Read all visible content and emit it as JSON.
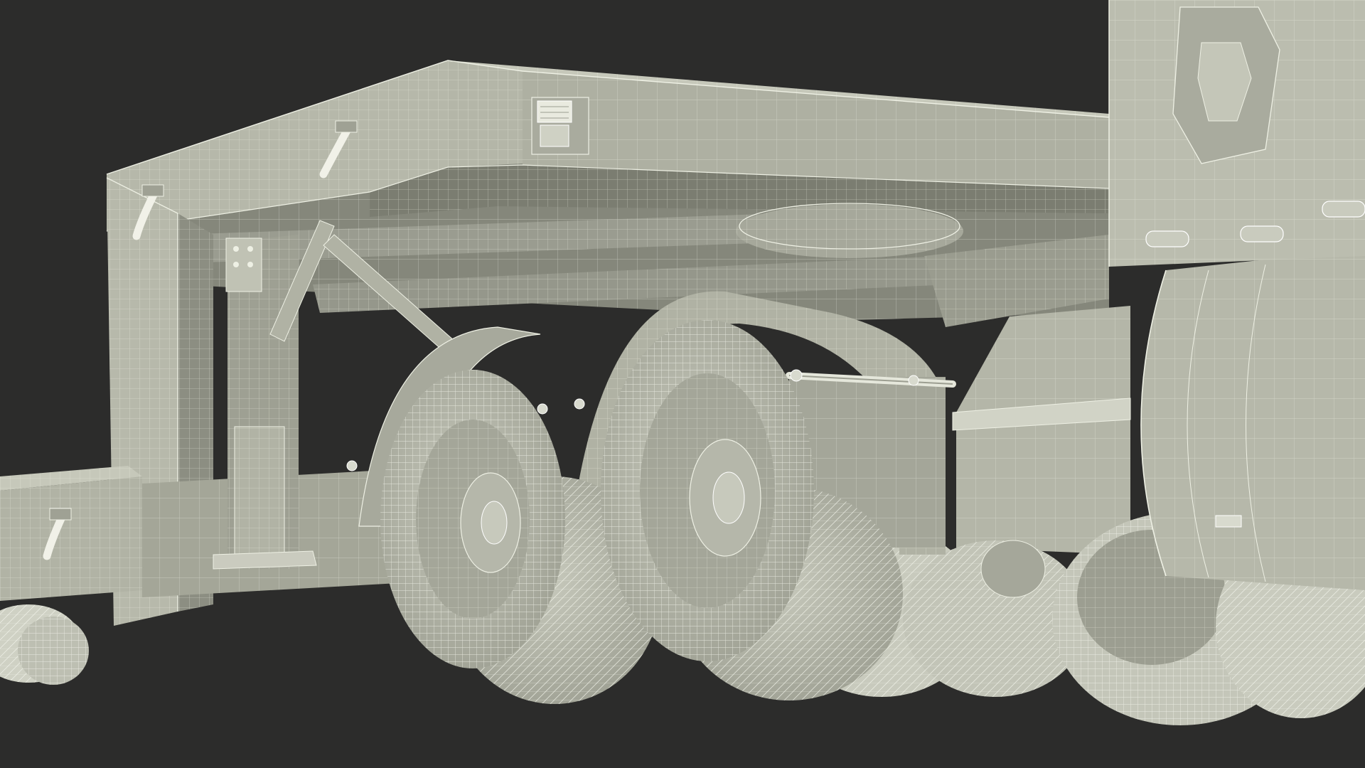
{
  "scene": {
    "subject": "semi-trailer-wireframe-render",
    "colors": {
      "background": "#2c2c2b",
      "body": "#b9bbad",
      "body_dark": "#8f9184",
      "body_shadow": "#6f7166",
      "wire": "#eef0e4",
      "tire": "#d9dbcf",
      "tire_dark": "#a8aa9d",
      "hook": "#f1f1e8"
    }
  }
}
